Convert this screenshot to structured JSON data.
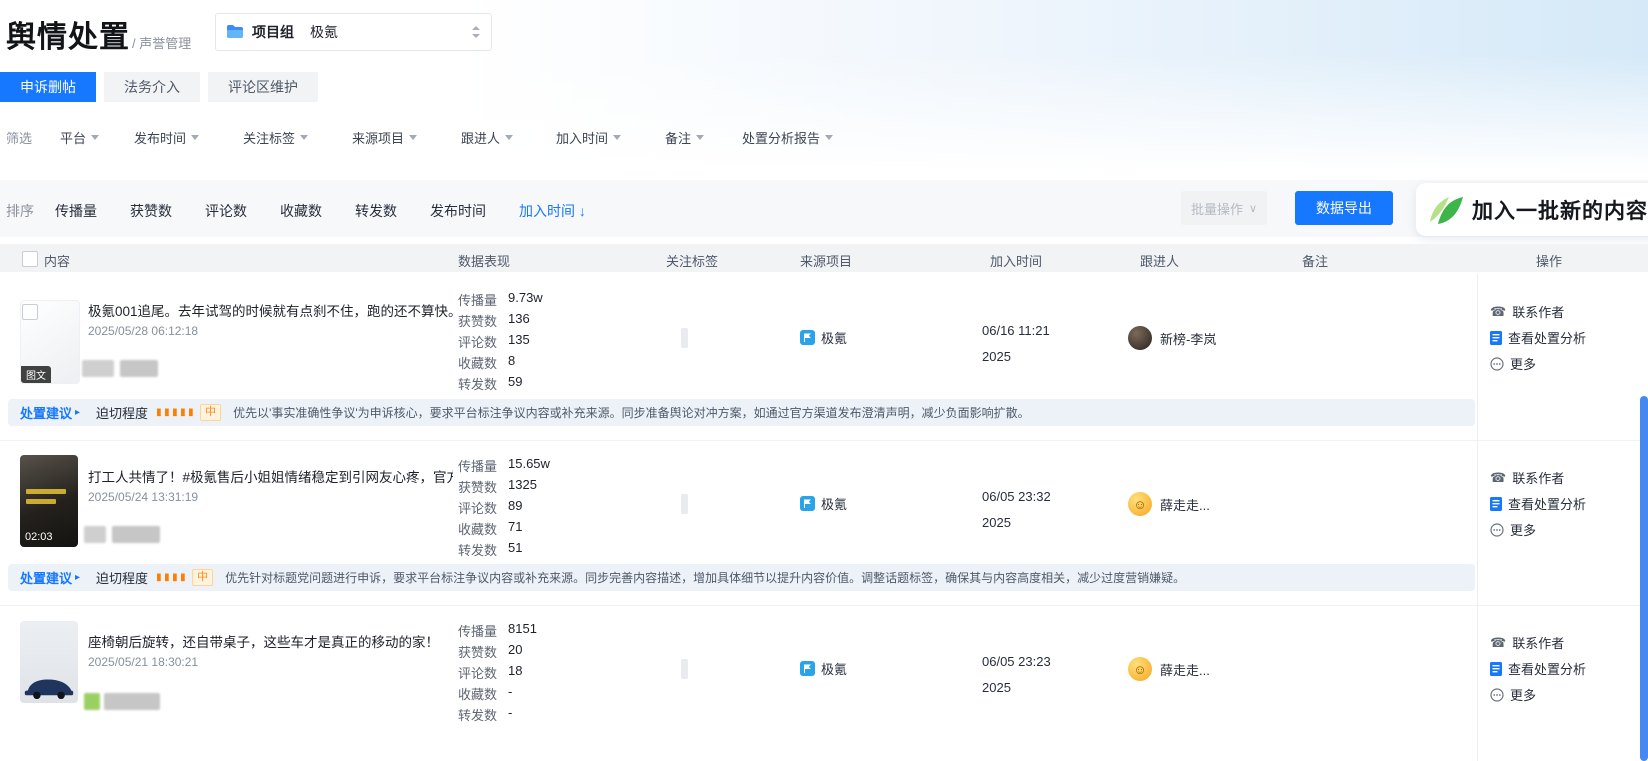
{
  "colors": {
    "accent": "#1677ff",
    "urgency_orange": "#ff7d00",
    "logo_green": "#3eb54a",
    "scrollbar_blue": "#4688f1"
  },
  "icons": {
    "expand_arrow": "▸",
    "phone": "☎",
    "chevron_down": "∨"
  },
  "header": {
    "title": "舆情处置",
    "subtitle": "/ 声誉管理",
    "project_selector": {
      "label": "项目组",
      "value": "极氪"
    }
  },
  "tabs": [
    {
      "label": "申诉删帖",
      "active": true
    },
    {
      "label": "法务介入",
      "active": false
    },
    {
      "label": "评论区维护",
      "active": false
    }
  ],
  "filter_bar": {
    "label": "筛选",
    "items": [
      "平台",
      "发布时间",
      "关注标签",
      "来源项目",
      "跟进人",
      "加入时间",
      "备注",
      "处置分析报告"
    ]
  },
  "sort_bar": {
    "label": "排序",
    "items": [
      "传播量",
      "获赞数",
      "评论数",
      "收藏数",
      "转发数",
      "发布时间"
    ],
    "active_item": "加入时间 ↓"
  },
  "toolbar": {
    "batch_button": "批量操作",
    "export_button": "数据导出",
    "add_banner": "加入一批新的内容"
  },
  "table": {
    "headers": [
      "内容",
      "数据表现",
      "关注标签",
      "来源项目",
      "加入时间",
      "跟进人",
      "备注",
      "操作"
    ],
    "metric_labels": [
      "传播量",
      "获赞数",
      "评论数",
      "收藏数",
      "转发数"
    ],
    "row_actions": {
      "contact": "联系作者",
      "report": "查看处置分析",
      "more": "更多"
    },
    "rows": [
      {
        "title": "极氪001追尾。去年试驾的时候就有点刹不住，跑的还不算快。...",
        "publish_time": "2025/05/28 06:12:18",
        "thumb_badge": "图文",
        "metrics": [
          "9.73w",
          "136",
          "135",
          "8",
          "59"
        ],
        "source": "极氪",
        "join_date": "06/16 11:21",
        "join_year": "2025",
        "follower": "新榜-李岚",
        "suggestion": {
          "label": "处置建议",
          "urgency_label": "迫切程度",
          "bars": "▮▮▮▮▮",
          "level": "中",
          "text": "优先以'事实准确性争议'为申诉核心，要求平台标注争议内容或补充来源。同步准备舆论对冲方案，如通过官方渠道发布澄清声明，减少负面影响扩散。"
        }
      },
      {
        "title": "打工人共情了！#极氪售后小姐姐情绪稳定到引网友心疼，官方...",
        "publish_time": "2025/05/24 13:31:19",
        "video_duration": "02:03",
        "metrics": [
          "15.65w",
          "1325",
          "89",
          "71",
          "51"
        ],
        "source": "极氪",
        "join_date": "06/05 23:32",
        "join_year": "2025",
        "follower": "薛走走...",
        "suggestion": {
          "label": "处置建议",
          "urgency_label": "迫切程度",
          "bars": "▮▮▮▮",
          "level": "中",
          "text": "优先针对标题党问题进行申诉，要求平台标注争议内容或补充来源。同步完善内容描述，增加具体细节以提升内容价值。调整话题标签，确保其与内容高度相关，减少过度营销嫌疑。"
        }
      },
      {
        "title": "座椅朝后旋转，还自带桌子，这些车才是真正的移动的家！",
        "publish_time": "2025/05/21 18:30:21",
        "metrics": [
          "8151",
          "20",
          "18",
          "-",
          "-"
        ],
        "source": "极氪",
        "join_date": "06/05 23:23",
        "join_year": "2025",
        "follower": "薛走走..."
      }
    ]
  }
}
